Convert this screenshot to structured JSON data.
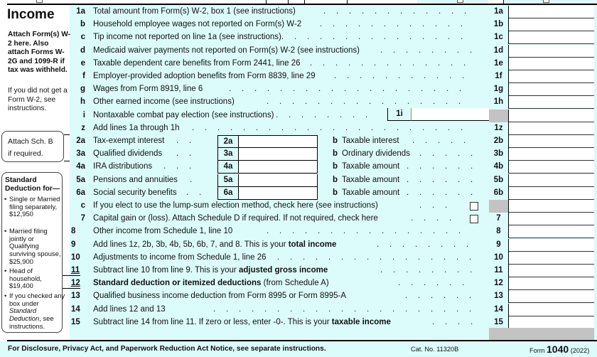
{
  "sidebar": {
    "section_title": "Income",
    "attach_note": "Attach Form(s) W-2 here. Also attach Forms W-2G and 1099-R if tax was withheld.",
    "w2_note": "If you did not get a Form W-2, see instructions.",
    "schedule_b_note": [
      "Attach Sch. B",
      "if required."
    ],
    "standard_deduction": {
      "title": "Standard Deduction for—",
      "items": [
        {
          "text": "Single or Married filing separately, $12,950"
        },
        {
          "text": "Married filing jointly or Qualifying surviving spouse, $25,900"
        },
        {
          "text": "Head of household, $19,400"
        },
        {
          "text": "If you checked any box under Standard Deduction, see instructions."
        }
      ]
    }
  },
  "lines": [
    {
      "num": "1a",
      "text": "Total amount from Form(s) W-2, box 1 (see instructions)",
      "ref": "1a",
      "amount": ""
    },
    {
      "num": "b",
      "text": "Household employee wages not reported on Form(s) W-2",
      "ref": "1b",
      "amount": ""
    },
    {
      "num": "c",
      "text": "Tip income not reported on line 1a (see instructions)",
      "ref": "1c",
      "amount": ""
    },
    {
      "num": "d",
      "text": "Medicaid waiver payments not reported on Form(s) W-2 (see instructions)",
      "ref": "1d",
      "amount": ""
    },
    {
      "num": "e",
      "text": "Taxable dependent care benefits from Form 2441, line 26",
      "ref": "1e",
      "amount": ""
    },
    {
      "num": "f",
      "text": "Employer-provided adoption benefits from Form 8839, line 29",
      "ref": "1f",
      "amount": ""
    },
    {
      "num": "g",
      "text": "Wages from Form 8919, line 6",
      "ref": "1g",
      "amount": ""
    },
    {
      "num": "h",
      "text": "Other earned income (see instructions)",
      "ref": "1h",
      "amount": ""
    },
    {
      "num": "i",
      "text": "Nontaxable combat pay election (see instructions)",
      "ref": "",
      "inline_label": "1i",
      "amount": ""
    },
    {
      "num": "z",
      "text": "Add lines 1a through 1h",
      "ref": "1z",
      "amount": ""
    }
  ],
  "paired_lines": [
    {
      "num": "2a",
      "text": "Tax-exempt interest",
      "a_label": "2a",
      "a_amount": "",
      "b_text": "Taxable interest",
      "ref": "2b",
      "amount": ""
    },
    {
      "num": "3a",
      "text": "Qualified dividends",
      "a_label": "3a",
      "a_amount": "",
      "b_text": "Ordinary dividends",
      "ref": "3b",
      "amount": ""
    },
    {
      "num": "4a",
      "text": "IRA distributions",
      "a_label": "4a",
      "a_amount": "",
      "b_text": "Taxable amount",
      "ref": "4b",
      "amount": ""
    },
    {
      "num": "5a",
      "text": "Pensions and annuities",
      "a_label": "5a",
      "a_amount": "",
      "b_text": "Taxable amount",
      "ref": "5b",
      "amount": ""
    },
    {
      "num": "6a",
      "text": "Social security benefits",
      "a_label": "6a",
      "a_amount": "",
      "b_text": "Taxable amount",
      "ref": "6b",
      "amount": ""
    }
  ],
  "b_prefix": "b",
  "line_6c": {
    "num": "c",
    "text": "If you elect to use the lump-sum election method, check here (see instructions)",
    "checked": false
  },
  "line_7": {
    "num": "7",
    "text": "Capital gain or (loss). Attach Schedule D if required. If not required, check here",
    "checked": false,
    "ref": "7",
    "amount": ""
  },
  "lower_lines": [
    {
      "num": "8",
      "pre": "Other income from Schedule 1, line 10",
      "bold": "",
      "post": "",
      "ref": "8",
      "amount": ""
    },
    {
      "num": "9",
      "pre": "Add lines 1z, 2b, 3b, 4b, 5b, 6b, 7, and 8. This is your ",
      "bold": "total income",
      "post": "",
      "ref": "9",
      "amount": ""
    },
    {
      "num": "10",
      "pre": "Adjustments to income from Schedule 1, line 26",
      "bold": "",
      "post": "",
      "ref": "10",
      "amount": ""
    },
    {
      "num": "11",
      "pre": "Subtract line 10 from line 9. This is your ",
      "bold": "adjusted gross income",
      "post": "",
      "ref": "11",
      "amount": ""
    },
    {
      "num": "12",
      "pre": "",
      "bold": "Standard deduction or itemized deductions",
      "post": " (from Schedule A)",
      "ref": "12",
      "amount": ""
    },
    {
      "num": "13",
      "pre": "Qualified business income deduction from Form 8995 or Form 8995-A",
      "bold": "",
      "post": "",
      "ref": "13",
      "amount": ""
    },
    {
      "num": "14",
      "pre": "Add lines 12 and 13",
      "bold": "",
      "post": "",
      "ref": "14",
      "amount": ""
    },
    {
      "num": "15",
      "pre": "Subtract line 14 from line 11. If zero or less, enter -0-. This is your ",
      "bold": "taxable income",
      "post": "",
      "ref": "15",
      "amount": ""
    }
  ],
  "footer": {
    "notice": "For Disclosure, Privacy Act, and Paperwork Reduction Act Notice, see separate instructions.",
    "cat_no": "Cat. No. 11320B",
    "form_prefix": "Form",
    "form_number": "1040",
    "form_year": "(2022)"
  },
  "colors": {
    "background_tint": "#dcfbfb",
    "shaded_cell": "#c3c3c3"
  }
}
